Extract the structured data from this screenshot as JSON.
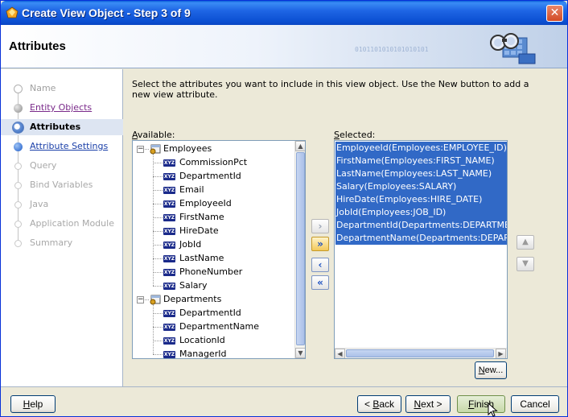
{
  "window": {
    "title": "Create View Object - Step 3 of 9",
    "close_symbol": "✕"
  },
  "header": {
    "title": "Attributes",
    "binary_text": "0101101010101010101",
    "graphic_icon": "binoculars-grid-icon"
  },
  "nav": {
    "items": [
      {
        "label": "Name",
        "state": "done"
      },
      {
        "label": "Entity Objects",
        "state": "visited"
      },
      {
        "label": "Attributes",
        "state": "current"
      },
      {
        "label": "Attribute Settings",
        "state": "link"
      },
      {
        "label": "Query",
        "state": "disabled"
      },
      {
        "label": "Bind Variables",
        "state": "disabled"
      },
      {
        "label": "Java",
        "state": "disabled"
      },
      {
        "label": "Application Module",
        "state": "disabled"
      },
      {
        "label": "Summary",
        "state": "disabled"
      }
    ]
  },
  "content": {
    "description": "Select the attributes you want to include in this view object.  Use the New button to add a new view attribute.",
    "available_label_prefix": "",
    "available_label_mnemonic": "A",
    "available_label_rest": "vailable:",
    "selected_label_mnemonic": "S",
    "selected_label_rest": "elected:",
    "available_tree": [
      {
        "name": "Employees",
        "toggle": "−",
        "children": [
          "CommissionPct",
          "DepartmentId",
          "Email",
          "EmployeeId",
          "FirstName",
          "HireDate",
          "JobId",
          "LastName",
          "PhoneNumber",
          "Salary"
        ]
      },
      {
        "name": "Departments",
        "toggle": "−",
        "children": [
          "DepartmentId",
          "DepartmentName",
          "LocationId",
          "ManagerId"
        ]
      }
    ],
    "attr_icon_text": "XYZ",
    "selected_items": [
      "EmployeeId(Employees:EMPLOYEE_ID)",
      "FirstName(Employees:FIRST_NAME)",
      "LastName(Employees:LAST_NAME)",
      "Salary(Employees:SALARY)",
      "HireDate(Employees:HIRE_DATE)",
      "JobId(Employees:JOB_ID)",
      "DepartmentId(Departments:DEPARTMENT_ID)",
      "DepartmentName(Departments:DEPARTMENT_NAME)"
    ],
    "shuttle": {
      "move_label": "›",
      "move_all_label": "»",
      "remove_label": "‹",
      "remove_all_label": "«"
    },
    "order": {
      "up_label": "▲",
      "down_label": "▼"
    },
    "new_button_mnemonic": "N",
    "new_button_rest": "ew..."
  },
  "footer": {
    "help_mnemonic": "H",
    "help_rest": "elp",
    "back_prefix": "< ",
    "back_mnemonic": "B",
    "back_rest": "ack",
    "next_mnemonic": "N",
    "next_rest": "ext >",
    "finish_mnemonic": "F",
    "finish_rest": "inish",
    "cancel_label": "Cancel"
  },
  "colors": {
    "titlebar": "#0b4fd2",
    "selection": "#3169c6",
    "link": "#1a3fa8",
    "visited": "#7a2a8a"
  }
}
